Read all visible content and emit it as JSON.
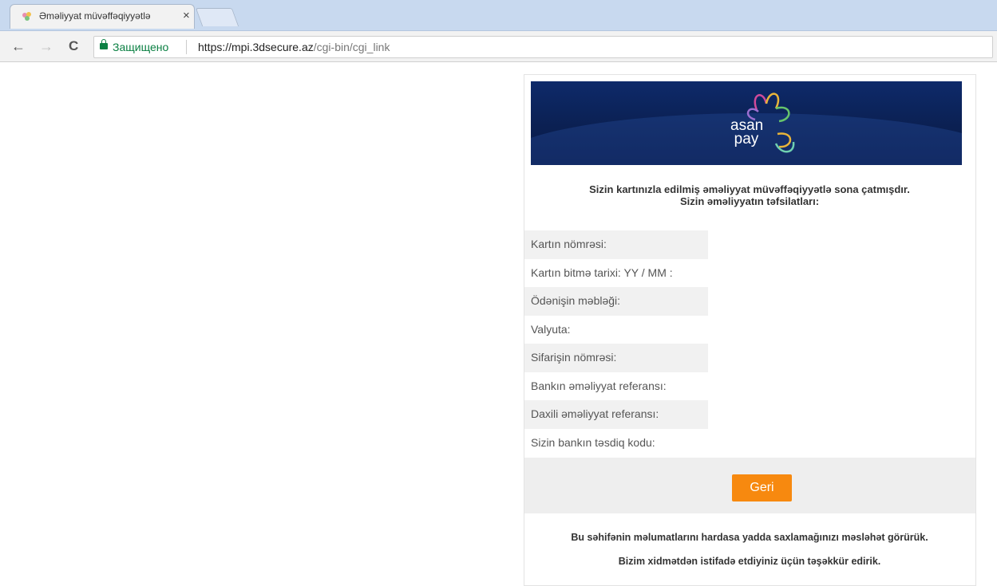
{
  "browser": {
    "tab_title": "Əməliyyat müvəffəqiyyətlə",
    "tab_close": "×",
    "secure_label": "Защищено",
    "url_host": "https://mpi.3dsecure.az",
    "url_path": "/cgi-bin/cgi_link",
    "back_icon": "←",
    "forward_icon": "→",
    "reload_icon": "C"
  },
  "page": {
    "logo_text_line1": "asan",
    "logo_text_line2": "pay",
    "success_line1": "Sizin kartınızla edilmiş əməliyyat müvəffəqiyyətlə sona çatmışdır.",
    "success_line2": "Sizin əməliyyatın təfsilatları:",
    "details": [
      "Kartın nömrəsi:",
      "Kartın bitmə tarixi: YY / MM :",
      "Ödənişin məbləği:",
      "Valyuta:",
      "Sifarişin nömrəsi:",
      "Bankın əməliyyat referansı:",
      "Daxili əməliyyat referansı:",
      "Sizin bankın təsdiq kodu:"
    ],
    "back_button": "Geri",
    "advice": "Bu səhifənin məlumatlarını hardasa yadda saxlamağınızı məsləhət görürük.",
    "thanks": "Bizim xidmətdən istifadə etdiyiniz üçün təşəkkür edirik."
  },
  "colors": {
    "accent_orange": "#f7890f",
    "banner_navy": "#0b2052",
    "secure_green": "#0b8043"
  }
}
